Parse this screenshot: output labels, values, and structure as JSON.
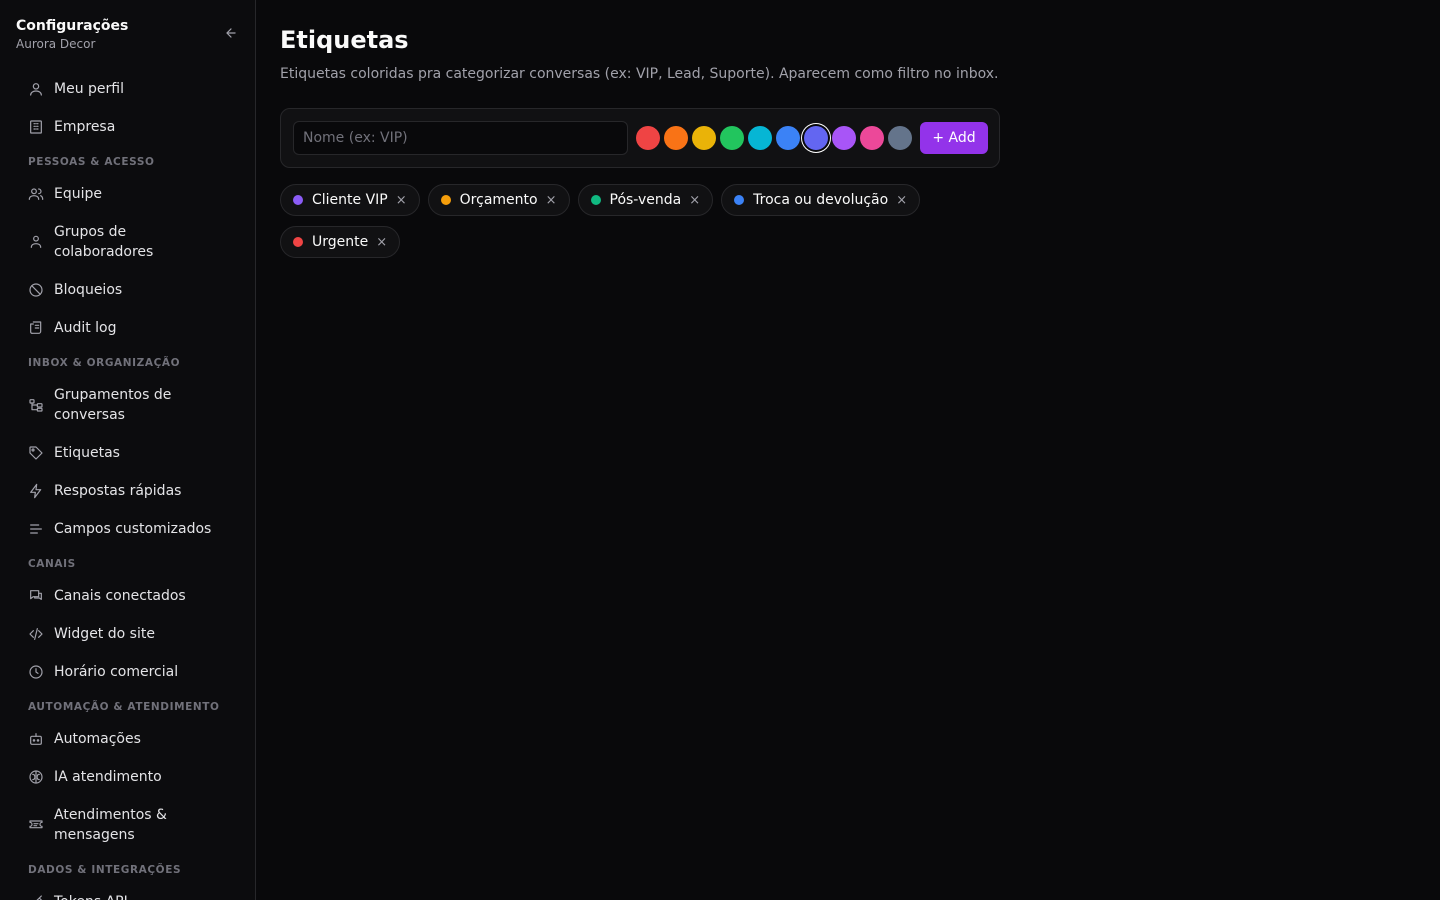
{
  "sidebar": {
    "title": "Configurações",
    "subtitle": "Aurora Decor",
    "items": [
      {
        "type": "item",
        "label": "Meu perfil",
        "icon": "user-icon"
      },
      {
        "type": "item",
        "label": "Empresa",
        "icon": "building-icon"
      },
      {
        "type": "section",
        "label": "PESSOAS & ACESSO"
      },
      {
        "type": "item",
        "label": "Equipe",
        "icon": "users-icon"
      },
      {
        "type": "item",
        "label": "Grupos de colaboradores",
        "icon": "user-group-icon"
      },
      {
        "type": "item",
        "label": "Bloqueios",
        "icon": "ban-icon"
      },
      {
        "type": "item",
        "label": "Audit log",
        "icon": "scroll-icon"
      },
      {
        "type": "section",
        "label": "INBOX & ORGANIZAÇÃO"
      },
      {
        "type": "item",
        "label": "Grupamentos de conversas",
        "icon": "folder-tree-icon"
      },
      {
        "type": "item",
        "label": "Etiquetas",
        "icon": "tag-icon"
      },
      {
        "type": "item",
        "label": "Respostas rápidas",
        "icon": "zap-icon"
      },
      {
        "type": "item",
        "label": "Campos customizados",
        "icon": "list-icon"
      },
      {
        "type": "section",
        "label": "CANAIS"
      },
      {
        "type": "item",
        "label": "Canais conectados",
        "icon": "chat-icon"
      },
      {
        "type": "item",
        "label": "Widget do site",
        "icon": "code-icon"
      },
      {
        "type": "item",
        "label": "Horário comercial",
        "icon": "clock-icon"
      },
      {
        "type": "section",
        "label": "AUTOMAÇÃO & ATENDIMENTO"
      },
      {
        "type": "item",
        "label": "Automações",
        "icon": "bot-icon"
      },
      {
        "type": "item",
        "label": "IA atendimento",
        "icon": "brain-icon"
      },
      {
        "type": "item",
        "label": "Atendimentos & mensagens",
        "icon": "ticket-icon"
      },
      {
        "type": "section",
        "label": "DADOS & INTEGRAÇÕES"
      },
      {
        "type": "item",
        "label": "Tokens API",
        "icon": "key-icon"
      }
    ]
  },
  "main": {
    "title": "Etiquetas",
    "description": "Etiquetas coloridas pra categorizar conversas (ex: VIP, Lead, Suporte). Aparecem como filtro no inbox.",
    "form": {
      "name_placeholder": "Nome (ex: VIP)",
      "name_value": "",
      "add_label": "+ Add",
      "colors": [
        "#ef4444",
        "#f97316",
        "#eab308",
        "#22c55e",
        "#06b6d4",
        "#3b82f6",
        "#6366f1",
        "#a855f7",
        "#ec4899",
        "#64748b"
      ],
      "selected_color": "#6366f1"
    },
    "tags": [
      {
        "label": "Cliente VIP",
        "color": "#8b5cf6"
      },
      {
        "label": "Orçamento",
        "color": "#f59e0b"
      },
      {
        "label": "Pós-venda",
        "color": "#10b981"
      },
      {
        "label": "Troca ou devolução",
        "color": "#3b82f6"
      },
      {
        "label": "Urgente",
        "color": "#ef4444"
      }
    ],
    "remove_glyph": "×"
  }
}
